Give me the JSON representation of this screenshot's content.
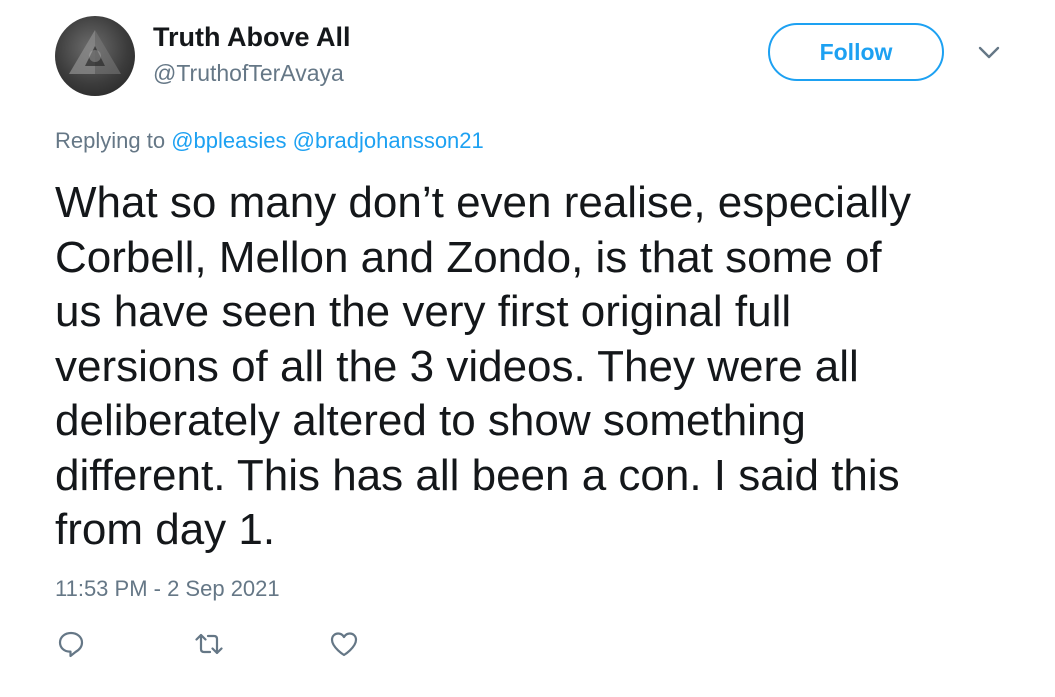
{
  "user": {
    "display_name": "Truth Above All",
    "handle": "@TruthofTerAvaya"
  },
  "header": {
    "follow_label": "Follow",
    "more_icon": "chevron-down-icon"
  },
  "reply_context": {
    "prefix": "Replying to",
    "mentions": [
      "@bpleasies",
      "@bradjohansson21"
    ]
  },
  "tweet": {
    "text": "What so many don’t even realise, especially\nCorbell, Mellon and Zondo, is that some of\nus have seen the very first original full\nversions of all the 3 videos. They were all\ndeliberately altered to show something\ndifferent. This has all been a con. I said this\nfrom day 1.",
    "timestamp": "11:53 PM - 2 Sep 2021"
  },
  "actions": {
    "icons": [
      "reply-icon",
      "retweet-icon",
      "like-icon"
    ]
  },
  "colors": {
    "accent": "#1da1f2",
    "secondary_text": "#657786",
    "primary_text": "#14171a"
  }
}
